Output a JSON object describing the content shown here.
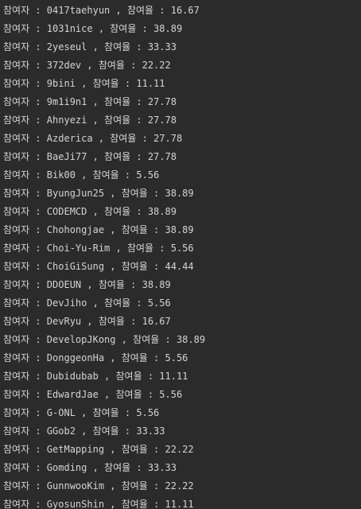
{
  "console": {
    "lines": [
      "참여자 : 0417taehyun , 참여율 : 16.67",
      "참여자 : 1031nice , 참여율 : 38.89",
      "참여자 : 2yeseul , 참여율 : 33.33",
      "참여자 : 372dev , 참여율 : 22.22",
      "참여자 : 9bini , 참여율 : 11.11",
      "참여자 : 9m1i9n1 , 참여율 : 27.78",
      "참여자 : Ahnyezi , 참여율 : 27.78",
      "참여자 : Azderica , 참여율 : 27.78",
      "참여자 : BaeJi77 , 참여율 : 27.78",
      "참여자 : Bik00 , 참여율 : 5.56",
      "참여자 : ByungJun25 , 참여율 : 38.89",
      "참여자 : CODEMCD , 참여율 : 38.89",
      "참여자 : Chohongjae , 참여율 : 38.89",
      "참여자 : Choi-Yu-Rim , 참여율 : 5.56",
      "참여자 : ChoiGiSung , 참여율 : 44.44",
      "참여자 : DDOEUN , 참여율 : 38.89",
      "참여자 : DevJiho , 참여율 : 5.56",
      "참여자 : DevRyu , 참여율 : 16.67",
      "참여자 : DevelopJKong , 참여율 : 38.89",
      "참여자 : DonggeonHa , 참여율 : 5.56",
      "참여자 : Dubidubab , 참여율 : 11.11",
      "참여자 : EdwardJae , 참여율 : 5.56",
      "참여자 : G-ONL , 참여율 : 5.56",
      "참여자 : GGob2 , 참여율 : 33.33",
      "참여자 : GetMapping , 참여율 : 22.22",
      "참여자 : Gomding , 참여율 : 33.33",
      "참여자 : GunnwooKim , 참여율 : 22.22",
      "참여자 : GyosunShin , 참여율 : 11.11"
    ]
  }
}
